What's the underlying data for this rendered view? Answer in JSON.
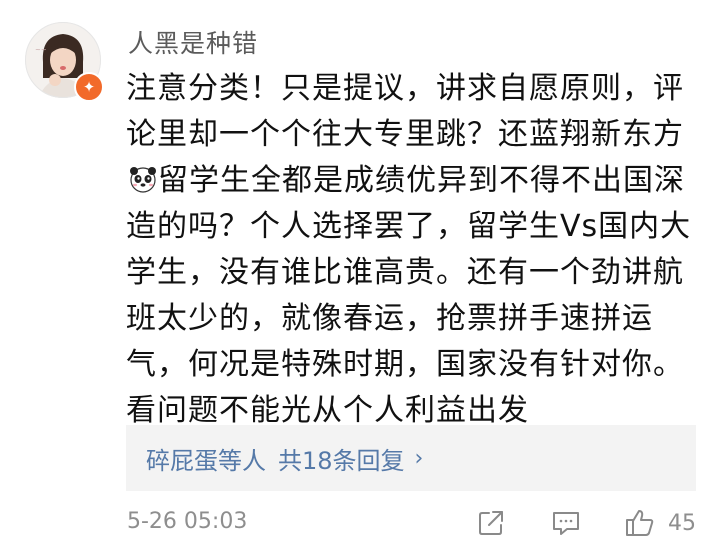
{
  "comment": {
    "username": "人黑是种错",
    "text_part1": "注意分类！只是提议，讲求自愿原则，评论里却一个个往大专里跳？还蓝翔新东方",
    "text_part2": "留学生全都是成绩优异到不得不出国深造的吗？个人选择罢了，留学生Vs国内大学生，没有谁比谁高贵。还有一个劲讲航班太少的，就像春运，抢票拼手速拼运气，何况是特殊时期，国家没有针对你。看问题不能光从个人利益出发",
    "inline_emoji_icon": "panda-face-icon",
    "avatar_badge_icon": "orange-star-badge-icon",
    "timestamp": "5-26 05:03",
    "like_count": "45"
  },
  "replies": {
    "users_label": "碎屁蛋等人",
    "count_label": "共18条回复",
    "chevron": "›",
    "accent_color": "#5579a8"
  },
  "actions": {
    "share_icon": "share-square-arrow-icon",
    "comment_icon": "comment-bubble-icon",
    "like_icon": "thumbs-up-icon"
  }
}
